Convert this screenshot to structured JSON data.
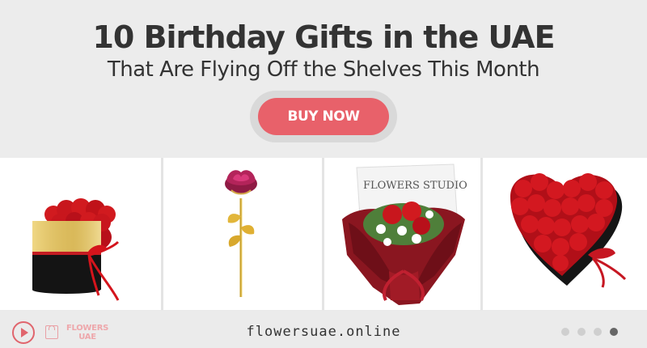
{
  "headline": {
    "title": "10 Birthday Gifts in the UAE",
    "subtitle": "That Are Flying Off the Shelves This Month",
    "cta_label": "BUY NOW"
  },
  "products": [
    {
      "icon": "preserved-roses-round-box-image"
    },
    {
      "icon": "gold-rose-image"
    },
    {
      "icon": "flowers-studio-rose-bouquet-image",
      "wrap_text": "FLOWERS STUDIO"
    },
    {
      "icon": "heart-box-roses-image"
    }
  ],
  "footer": {
    "logo_line1": "FLOWERS",
    "logo_line2": "UAE",
    "website": "flowersuae.online",
    "carousel": {
      "count": 4,
      "active_index": 3
    }
  },
  "colors": {
    "accent": "#e8616a",
    "rose_red": "#d11a1f",
    "text": "#333333",
    "background": "#ececec"
  }
}
